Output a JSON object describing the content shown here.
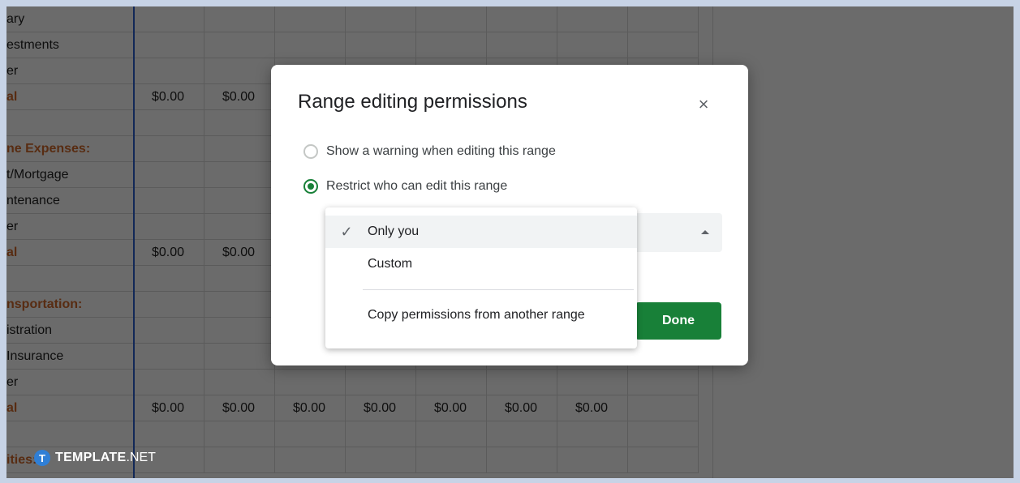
{
  "sheet": {
    "rows": [
      {
        "label": "ary",
        "style": "normal",
        "values": []
      },
      {
        "label": "estments",
        "style": "normal",
        "values": []
      },
      {
        "label": "er",
        "style": "normal",
        "values": []
      },
      {
        "label": "al",
        "style": "total",
        "values": [
          "$0.00",
          "$0.00"
        ]
      },
      {
        "label": "",
        "style": "normal",
        "values": []
      },
      {
        "label": "ne Expenses:",
        "style": "header",
        "values": []
      },
      {
        "label": "t/Mortgage",
        "style": "normal",
        "values": []
      },
      {
        "label": "ntenance",
        "style": "normal",
        "values": []
      },
      {
        "label": "er",
        "style": "normal",
        "values": []
      },
      {
        "label": "al",
        "style": "total",
        "values": [
          "$0.00",
          "$0.00"
        ]
      },
      {
        "label": "",
        "style": "normal",
        "values": []
      },
      {
        "label": "nsportation:",
        "style": "header",
        "values": []
      },
      {
        "label": "istration",
        "style": "normal",
        "values": []
      },
      {
        "label": "Insurance",
        "style": "normal",
        "values": []
      },
      {
        "label": "er",
        "style": "normal",
        "values": []
      },
      {
        "label": "al",
        "style": "total",
        "values": [
          "$0.00",
          "$0.00",
          "$0.00",
          "$0.00",
          "$0.00",
          "$0.00",
          "$0.00"
        ]
      },
      {
        "label": "",
        "style": "normal",
        "values": []
      },
      {
        "label": "ities:",
        "style": "header",
        "values": []
      }
    ]
  },
  "dialog": {
    "title": "Range editing permissions",
    "close_icon": "×",
    "option_warning": "Show a warning when editing this range",
    "option_restrict": "Restrict who can edit this range",
    "done_label": "Done"
  },
  "menu": {
    "check_icon": "✓",
    "items": [
      {
        "label": "Only you",
        "selected": true
      },
      {
        "label": "Custom",
        "selected": false
      },
      {
        "label": "Copy permissions from another range",
        "selected": false
      }
    ]
  },
  "watermark": {
    "logo_letter": "T",
    "brand": "TEMPLATE",
    "suffix": ".NET"
  },
  "colors": {
    "accent_green": "#188038",
    "header_orange": "#d16a2b",
    "selection_blue": "#2b5fd0"
  }
}
